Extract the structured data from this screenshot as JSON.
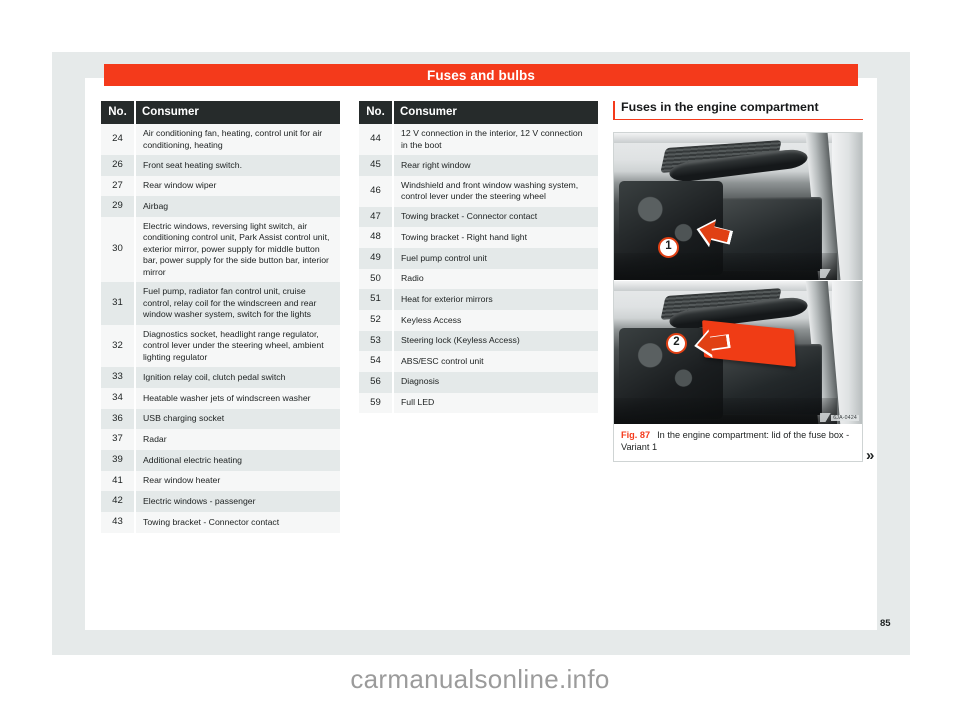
{
  "document": {
    "banner_title": "Fuses and bulbs",
    "page_number": "85",
    "continuation_marker": "»",
    "watermark": "carmanualsonline.info"
  },
  "table_left": {
    "headers": {
      "no": "No.",
      "consumer": "Consumer"
    },
    "rows": [
      {
        "no": "24",
        "consumer": "Air conditioning fan, heating, control unit for air conditioning, heating"
      },
      {
        "no": "26",
        "consumer": "Front seat heating switch."
      },
      {
        "no": "27",
        "consumer": "Rear window wiper"
      },
      {
        "no": "29",
        "consumer": "Airbag"
      },
      {
        "no": "30",
        "consumer": "Electric windows, reversing light switch, air conditioning control unit, Park Assist control unit, exterior mirror, power supply for middle button bar, power supply for the side button bar, interior mirror"
      },
      {
        "no": "31",
        "consumer": "Fuel pump, radiator fan control unit, cruise control, relay coil for the windscreen and rear window washer system, switch for the lights"
      },
      {
        "no": "32",
        "consumer": "Diagnostics socket, headlight range regulator, control lever under the steering wheel, ambient lighting regulator"
      },
      {
        "no": "33",
        "consumer": "Ignition relay coil, clutch pedal switch"
      },
      {
        "no": "34",
        "consumer": "Heatable washer jets of windscreen washer"
      },
      {
        "no": "36",
        "consumer": "USB charging socket"
      },
      {
        "no": "37",
        "consumer": "Radar"
      },
      {
        "no": "39",
        "consumer": "Additional electric heating"
      },
      {
        "no": "41",
        "consumer": "Rear window heater"
      },
      {
        "no": "42",
        "consumer": "Electric windows - passenger"
      },
      {
        "no": "43",
        "consumer": "Towing bracket - Connector contact"
      }
    ]
  },
  "table_right": {
    "headers": {
      "no": "No.",
      "consumer": "Consumer"
    },
    "rows": [
      {
        "no": "44",
        "consumer": "12 V connection in the interior, 12 V connection in the boot"
      },
      {
        "no": "45",
        "consumer": "Rear right window"
      },
      {
        "no": "46",
        "consumer": "Windshield and front window washing system, control lever under the steering wheel"
      },
      {
        "no": "47",
        "consumer": "Towing bracket - Connector contact"
      },
      {
        "no": "48",
        "consumer": "Towing bracket - Right hand light"
      },
      {
        "no": "49",
        "consumer": "Fuel pump control unit"
      },
      {
        "no": "50",
        "consumer": "Radio"
      },
      {
        "no": "51",
        "consumer": "Heat for exterior mirrors"
      },
      {
        "no": "52",
        "consumer": "Keyless Access"
      },
      {
        "no": "53",
        "consumer": "Steering lock (Keyless Access)"
      },
      {
        "no": "54",
        "consumer": "ABS/ESC control unit"
      },
      {
        "no": "56",
        "consumer": "Diagnosis"
      },
      {
        "no": "59",
        "consumer": "Full LED"
      }
    ]
  },
  "sidebar": {
    "section_heading": "Fuses in the engine compartment",
    "figure": {
      "label": "Fig. 87",
      "caption": "In the engine compartment: lid of the fuse box - Variant 1",
      "photo_code": "6JA-0424",
      "callouts": [
        {
          "number": "1",
          "image": "engine-bay-fuse-box-closed"
        },
        {
          "number": "2",
          "image": "engine-bay-fuse-box-lid-open"
        }
      ]
    }
  },
  "colors": {
    "accent_red": "#f43a1b",
    "header_dark": "#262b2b",
    "row_light": "#f6f7f7",
    "row_shaded": "#e4e9e9",
    "mat_grey": "#e6eaea"
  }
}
